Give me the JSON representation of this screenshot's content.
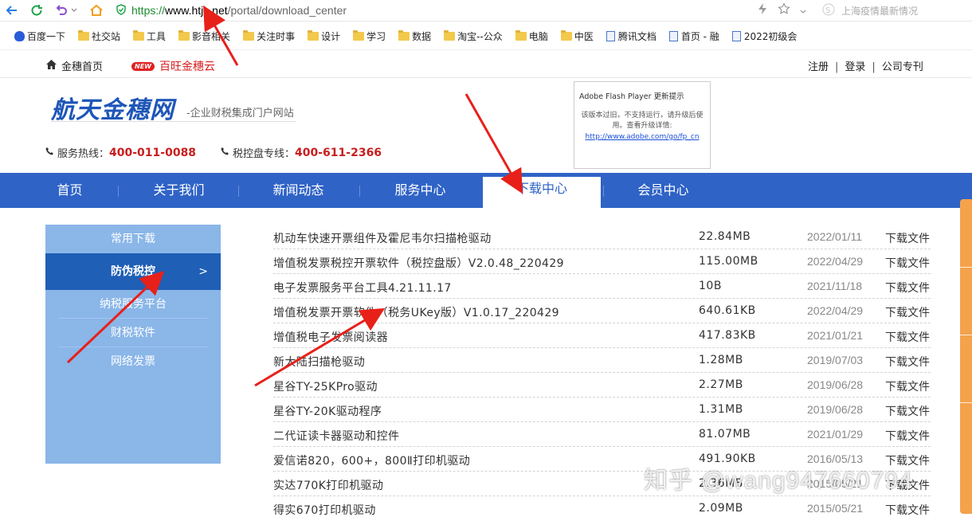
{
  "browser": {
    "url_proto": "https://",
    "url_host": "www.htjs.net",
    "url_path": "/portal/download_center",
    "search_placeholder": "上海疫情最新情况"
  },
  "bookmarks": [
    {
      "label": "百度一下",
      "icon": "baidu-icon"
    },
    {
      "label": "社交站",
      "icon": "folder-icon"
    },
    {
      "label": "工具",
      "icon": "folder-icon"
    },
    {
      "label": "影音相关",
      "icon": "folder-icon"
    },
    {
      "label": "关注时事",
      "icon": "folder-icon"
    },
    {
      "label": "设计",
      "icon": "folder-icon"
    },
    {
      "label": "学习",
      "icon": "folder-icon"
    },
    {
      "label": "数据",
      "icon": "folder-icon"
    },
    {
      "label": "淘宝--公众",
      "icon": "folder-icon"
    },
    {
      "label": "电脑",
      "icon": "folder-icon"
    },
    {
      "label": "中医",
      "icon": "folder-icon"
    },
    {
      "label": "腾讯文档",
      "icon": "doc-icon"
    },
    {
      "label": "首页 - 融",
      "icon": "page-icon"
    },
    {
      "label": "2022初级会",
      "icon": "page-icon"
    }
  ],
  "site_top": {
    "home": "金穗首页",
    "new_badge": "NEW",
    "promo": "百旺金穗云",
    "links": [
      "注册",
      "登录",
      "公司专刊"
    ],
    "sep": "|"
  },
  "header": {
    "logo": "航天金穗网",
    "subtitle": "-企业财税集成门户网站",
    "hotline_label": "服务热线：",
    "hotline": "400-011-0088",
    "tax_label": "税控盘专线：",
    "tax_line": "400-611-2366"
  },
  "flash": {
    "title": "Adobe Flash Player 更新提示",
    "message": "该版本过旧，不支持运行，请升级后使用。查看升级详情:",
    "link": "http://www.adobe.com/go/fp_cn"
  },
  "nav": {
    "items": [
      "首页",
      "关于我们",
      "新闻动态",
      "服务中心",
      "下载中心",
      "会员中心"
    ],
    "active": "下载中心"
  },
  "sidebar": {
    "header": "常用下载",
    "active": "防伪税控",
    "chevron": ">",
    "items": [
      "纳税服务平台",
      "财税软件",
      "网络发票"
    ]
  },
  "downloads": [
    {
      "name": "机动车快速开票组件及霍尼韦尔扫描枪驱动",
      "size": "22.84MB",
      "date": "2022/01/11",
      "action": "下载文件"
    },
    {
      "name": "增值税发票税控开票软件（税控盘版）V2.0.48_220429",
      "size": "115.00MB",
      "date": "2022/04/29",
      "action": "下载文件"
    },
    {
      "name": "电子发票服务平台工具4.21.11.17",
      "size": "10B",
      "date": "2021/11/18",
      "action": "下载文件"
    },
    {
      "name": "增值税发票开票软件（税务UKey版）V1.0.17_220429",
      "size": "640.61KB",
      "date": "2022/04/29",
      "action": "下载文件"
    },
    {
      "name": "增值税电子发票阅读器",
      "size": "417.83KB",
      "date": "2021/01/21",
      "action": "下载文件"
    },
    {
      "name": "新大陆扫描枪驱动",
      "size": "1.28MB",
      "date": "2019/07/03",
      "action": "下载文件"
    },
    {
      "name": "星谷TY-25KPro驱动",
      "size": "2.27MB",
      "date": "2019/06/28",
      "action": "下载文件"
    },
    {
      "name": "星谷TY-20K驱动程序",
      "size": "1.31MB",
      "date": "2019/06/28",
      "action": "下载文件"
    },
    {
      "name": "二代证读卡器驱动和控件",
      "size": "81.07MB",
      "date": "2021/01/29",
      "action": "下载文件"
    },
    {
      "name": "爱信诺820，600+，800Ⅱ打印机驱动",
      "size": "491.90KB",
      "date": "2016/05/13",
      "action": "下载文件"
    },
    {
      "name": "实达770K打印机驱动",
      "size": "2.36MB",
      "date": "2015/05/21",
      "action": "下载文件"
    },
    {
      "name": "得实670打印机驱动",
      "size": "2.09MB",
      "date": "2015/05/21",
      "action": "下载文件"
    }
  ],
  "watermark": "知乎 @wang947660794",
  "colors": {
    "nav_blue": "#2f63c6",
    "sidebar_blue": "#8ab6e8",
    "sidebar_active": "#1f5fb5",
    "accent_red": "#c81e1e",
    "annotation_red": "#e8201a"
  }
}
